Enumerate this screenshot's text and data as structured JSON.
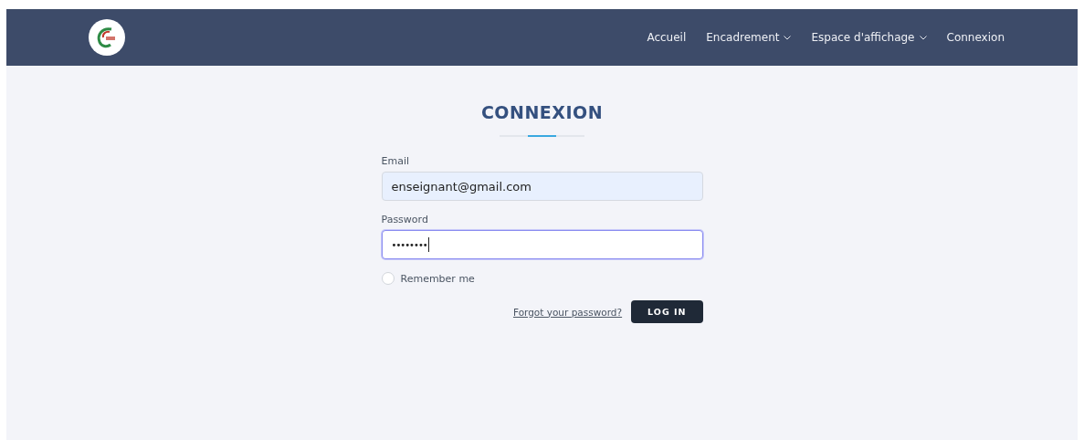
{
  "nav": {
    "items": [
      {
        "label": "Accueil",
        "kind": "link"
      },
      {
        "label": "Encadrement",
        "kind": "dropdown"
      },
      {
        "label": "Espace d'affichage",
        "kind": "dropdown"
      },
      {
        "label": "Connexion",
        "kind": "link"
      }
    ]
  },
  "login": {
    "title": "CONNEXION",
    "fields": [
      {
        "label": "Email",
        "value": "enseignant@gmail.com",
        "kind": "email",
        "focused": false
      },
      {
        "label": "Password",
        "value": "••••••••",
        "kind": "password",
        "focused": true
      }
    ],
    "remember": {
      "label": "Remember me",
      "checked": false
    },
    "forgot_link": "Forgot your password?",
    "submit": "LOG IN"
  }
}
